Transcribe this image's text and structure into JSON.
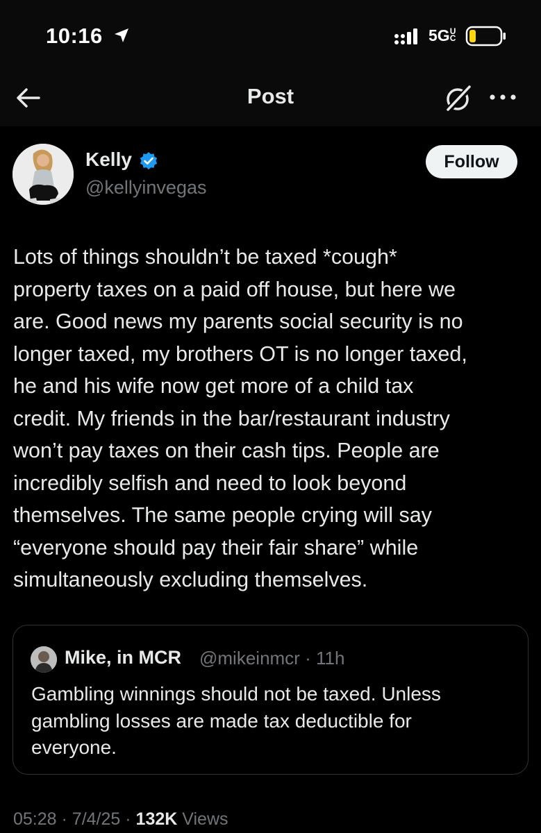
{
  "status_bar": {
    "time": "10:16",
    "network": "5G",
    "network_sub": "UC",
    "battery_color": "#ffd60a",
    "icons": [
      "location-arrow-icon",
      "signal-icon",
      "battery-icon"
    ]
  },
  "nav": {
    "title": "Post",
    "icons": [
      "back-arrow-icon",
      "grok-icon",
      "more-icon"
    ]
  },
  "author": {
    "name": "Kelly",
    "handle": "@kellyinvegas",
    "verified": true,
    "verified_color": "#1d9bf0",
    "follow_label": "Follow"
  },
  "post": {
    "lines": [
      "Lots of things shouldn’t be taxed *cough*",
      "property taxes on a paid off house, but here we",
      "are. Good news my parents social security is no",
      "longer taxed, my brothers OT is no longer taxed,",
      "he and his wife now get more of a child tax",
      "credit. My friends in the bar/restaurant industry",
      "won’t pay taxes on their cash tips. People are",
      "incredibly selfish and need to look beyond",
      "themselves. The same people crying will say",
      "“everyone should pay their fair share” while",
      "simultaneously excluding themselves."
    ]
  },
  "quote": {
    "name": "Mike, in MCR",
    "handle": "@mikeinmcr",
    "time": "11h",
    "separator": "·",
    "lines": [
      "Gambling winnings should not be taxed. Unless",
      "gambling losses are made tax deductible for",
      "everyone."
    ]
  },
  "meta": {
    "time": "05:28",
    "date": "7/4/25",
    "separator": "·",
    "views_count": "132K",
    "views_label": "Views"
  }
}
